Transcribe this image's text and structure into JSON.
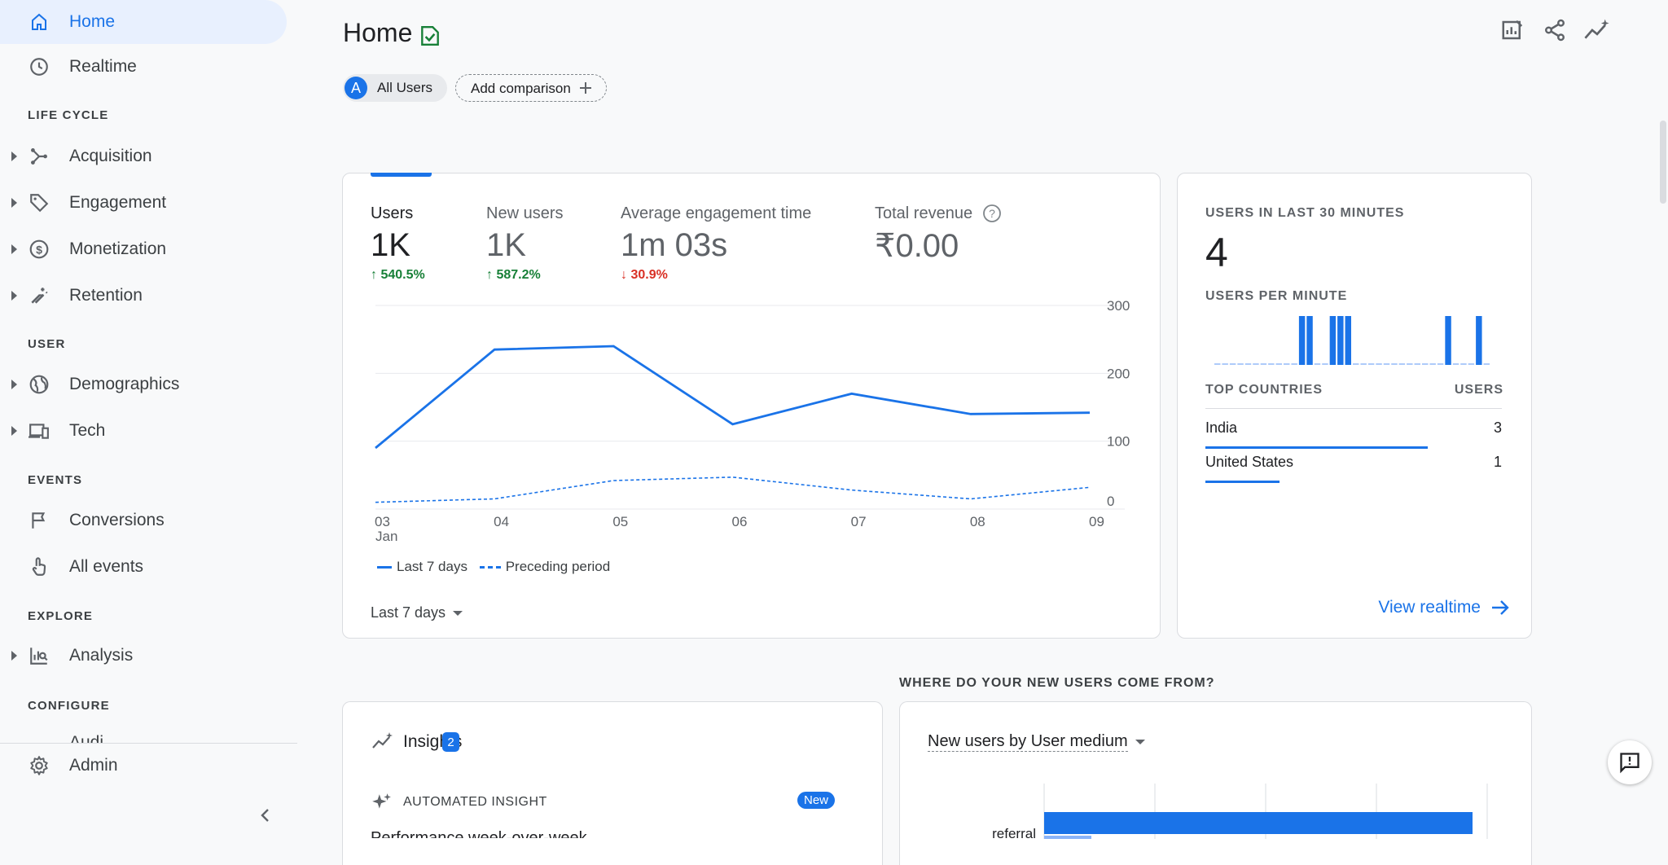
{
  "sidebar": {
    "home": "Home",
    "realtime": "Realtime",
    "sections": {
      "lifecycle": "LIFE CYCLE",
      "user": "USER",
      "events": "EVENTS",
      "explore": "EXPLORE",
      "configure": "CONFIGURE"
    },
    "items": {
      "acquisition": "Acquisition",
      "engagement": "Engagement",
      "monetization": "Monetization",
      "retention": "Retention",
      "demographics": "Demographics",
      "tech": "Tech",
      "conversions": "Conversions",
      "all_events": "All events",
      "analysis": "Analysis",
      "audiences_partial": "Audi"
    },
    "admin": "Admin"
  },
  "header": {
    "title": "Home",
    "segment_avatar": "A",
    "segment_label": "All Users",
    "add_comparison": "Add comparison"
  },
  "metrics": [
    {
      "label": "Users",
      "value": "1K",
      "change": "540.5%",
      "direction": "up"
    },
    {
      "label": "New users",
      "value": "1K",
      "change": "587.2%",
      "direction": "up"
    },
    {
      "label": "Average engagement time",
      "value": "1m 03s",
      "change": "30.9%",
      "direction": "down"
    },
    {
      "label": "Total revenue",
      "value": "₹0.00"
    }
  ],
  "chart_data": {
    "type": "line",
    "x": [
      "03",
      "04",
      "05",
      "06",
      "07",
      "08",
      "09"
    ],
    "x_sublabel": "Jan",
    "yticks": [
      "300",
      "200",
      "100",
      "0"
    ],
    "ylim": [
      0,
      300
    ],
    "series": [
      {
        "name": "Last 7 days",
        "values": [
          90,
          235,
          240,
          125,
          170,
          140,
          142
        ],
        "style": "solid",
        "color": "#1a73e8"
      },
      {
        "name": "Preceding period",
        "values": [
          10,
          15,
          42,
          47,
          28,
          15,
          32
        ],
        "style": "dashed",
        "color": "#1a73e8"
      }
    ],
    "legend": [
      "Last 7 days",
      "Preceding period"
    ],
    "grid": true
  },
  "date_range": "Last 7 days",
  "realtime": {
    "title": "USERS IN LAST 30 MINUTES",
    "count": "4",
    "per_minute_label": "USERS PER MINUTE",
    "per_minute": [
      0,
      0,
      0,
      0,
      0,
      0,
      0,
      0,
      0,
      0,
      0,
      1,
      1,
      0,
      0,
      1,
      1,
      1,
      0,
      0,
      0,
      0,
      0,
      0,
      0,
      0,
      0,
      0,
      0,
      0,
      1,
      0,
      0,
      0,
      1,
      0
    ],
    "countries_header": "TOP COUNTRIES",
    "users_header": "USERS",
    "countries": [
      {
        "name": "India",
        "value": "3",
        "share": 0.75
      },
      {
        "name": "United States",
        "value": "1",
        "share": 0.25
      }
    ],
    "view_link": "View realtime"
  },
  "section_title": "WHERE DO YOUR NEW USERS COME FROM?",
  "insights": {
    "title": "Insights",
    "badge": "2",
    "automated": "AUTOMATED INSIGHT",
    "new_badge": "New",
    "headline_partial": "Performance week-over-week"
  },
  "new_users": {
    "dropdown": "New users by User medium",
    "bar_label": "referral"
  },
  "colors": {
    "accent": "#1a73e8",
    "up": "#188038",
    "down": "#d93025"
  }
}
